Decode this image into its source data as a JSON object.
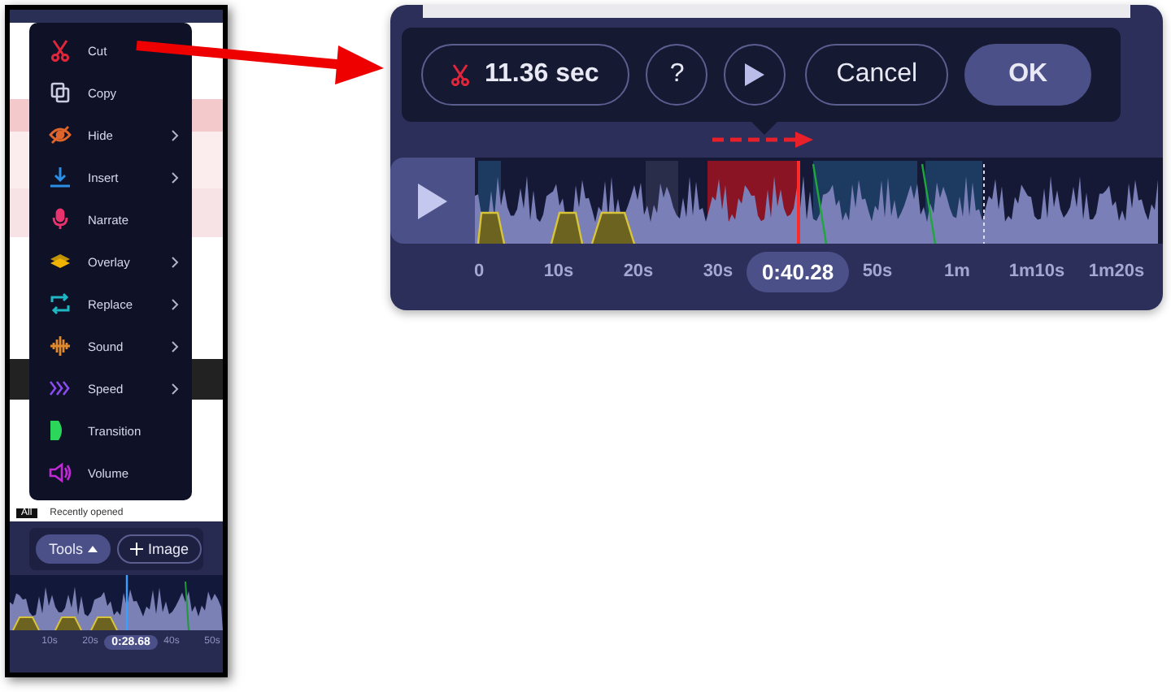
{
  "phone": {
    "menu": [
      {
        "label": "Cut",
        "kind": "scissors",
        "color": "#e0263a",
        "submenu": false
      },
      {
        "label": "Copy",
        "kind": "copy",
        "color": "#c9cbe0",
        "submenu": false
      },
      {
        "label": "Hide",
        "kind": "eye",
        "color": "#e0652b",
        "submenu": true
      },
      {
        "label": "Insert",
        "kind": "insert",
        "color": "#2b8fe8",
        "submenu": true
      },
      {
        "label": "Narrate",
        "kind": "mic",
        "color": "#e8336e",
        "submenu": false
      },
      {
        "label": "Overlay",
        "kind": "layers",
        "color": "#f0b400",
        "submenu": true
      },
      {
        "label": "Replace",
        "kind": "replace",
        "color": "#1fb7c4",
        "submenu": true
      },
      {
        "label": "Sound",
        "kind": "sound",
        "color": "#e08a2b",
        "submenu": true
      },
      {
        "label": "Speed",
        "kind": "speed",
        "color": "#8a4bf0",
        "submenu": true
      },
      {
        "label": "Transition",
        "kind": "transition",
        "color": "#2bd65a",
        "submenu": false
      },
      {
        "label": "Volume",
        "kind": "volume",
        "color": "#c02bd6",
        "submenu": false
      }
    ],
    "tabs": [
      "All",
      "Recently opened"
    ],
    "tools_button": {
      "label": "Tools",
      "expanded": true
    },
    "image_button": {
      "label": "Image"
    },
    "axis": [
      {
        "kind": "tick",
        "label": "10s"
      },
      {
        "kind": "tick",
        "label": "20s"
      },
      {
        "kind": "playhead",
        "label": "0:28.68"
      },
      {
        "kind": "tick",
        "label": "40s"
      },
      {
        "kind": "tick",
        "label": "50s"
      }
    ]
  },
  "cut_panel": {
    "duration": "11.36 sec",
    "help": "?",
    "cancel": "Cancel",
    "ok": "OK",
    "axis": [
      {
        "kind": "tick",
        "label": "0"
      },
      {
        "kind": "tick",
        "label": "10s"
      },
      {
        "kind": "tick",
        "label": "20s"
      },
      {
        "kind": "tick",
        "label": "30s"
      },
      {
        "kind": "playhead",
        "label": "0:40.28"
      },
      {
        "kind": "tick",
        "label": "50s"
      },
      {
        "kind": "tick",
        "label": "1m"
      },
      {
        "kind": "tick",
        "label": "1m10s"
      },
      {
        "kind": "tick",
        "label": "1m20s"
      }
    ]
  }
}
